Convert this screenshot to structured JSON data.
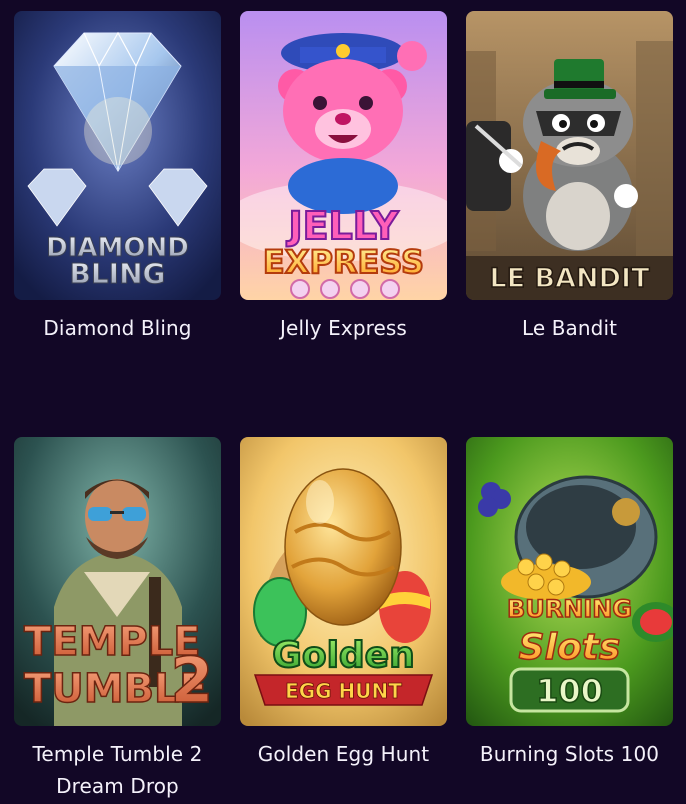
{
  "games": [
    {
      "title": "Diamond Bling",
      "logo_line1": "DIAMOND",
      "logo_line2": "BLING",
      "icon": "diamond-icon"
    },
    {
      "title": "Jelly Express",
      "logo_line1": "JELLY",
      "logo_line2": "EXPRESS",
      "icon": "bear-icon"
    },
    {
      "title": "Le Bandit",
      "logo_line1": "LE BANDIT",
      "icon": "raccoon-icon"
    },
    {
      "title": "Temple Tumble 2 Dream Drop",
      "logo_line1": "TEMPLE",
      "logo_line2": "TUMBLE",
      "logo_num": "2",
      "icon": "explorer-icon"
    },
    {
      "title": "Golden Egg Hunt",
      "logo_line1": "Golden",
      "logo_line2": "EGG HUNT",
      "icon": "egg-icon"
    },
    {
      "title": "Burning Slots 100",
      "logo_line1": "BURNING",
      "logo_line2": "Slots",
      "logo_num": "100",
      "icon": "pot-of-gold-icon"
    }
  ],
  "colors": {
    "background": "#120726",
    "title_text": "#f4f1fa"
  }
}
